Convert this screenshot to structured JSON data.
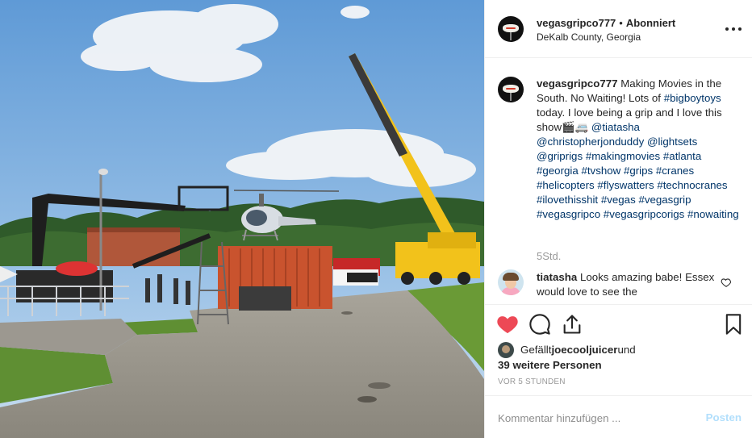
{
  "post": {
    "username": "vegasgripco777",
    "follow_status": "Abonniert",
    "separator": "•",
    "location": "DeKalb County, Georgia",
    "more_icon": "more-options-icon"
  },
  "caption": {
    "username": "vegasgripco777",
    "text_plain_1": "Making Movies in the South. No Waiting! Lots of ",
    "tag_1": "#bigboytoys",
    "text_plain_2": " today. I love being a grip and I love this show🎬🚐 ",
    "mention_1": "@tiatasha",
    "mention_2": "@christopherjonduddy",
    "mention_3": "@lightsets",
    "mention_4": "@griprigs",
    "tag_2": "#makingmovies",
    "tag_3": "#atlanta",
    "tag_4": "#georgia",
    "tag_5": "#tvshow",
    "tag_6": "#grips",
    "tag_7": "#cranes",
    "tag_8": "#helicopters",
    "tag_9": "#flyswatters",
    "tag_10": "#technocranes",
    "tag_11": "#ilovethisshit",
    "tag_12": "#vegas",
    "tag_13": "#vegasgrip",
    "tag_14": "#vegasgripco",
    "tag_15": "#vegasgripcorigs",
    "tag_16": "#nowaiting",
    "time": "5Std."
  },
  "comment": {
    "username": "tiatasha",
    "text": "Looks amazing babe! Essex would love to see the"
  },
  "actions": {
    "like_icon": "heart-filled-icon",
    "comment_icon": "comment-bubble-icon",
    "share_icon": "share-upload-icon",
    "save_icon": "bookmark-icon",
    "like_color": "#ed4956"
  },
  "likes": {
    "prefix": "Gefällt ",
    "user": "joecooljuicer",
    "mid": " und",
    "others": "39 weitere Personen"
  },
  "timestamp": "VOR 5 STUNDEN",
  "add_comment": {
    "placeholder": "Kommentar hinzufügen ...",
    "post_label": "Posten"
  }
}
